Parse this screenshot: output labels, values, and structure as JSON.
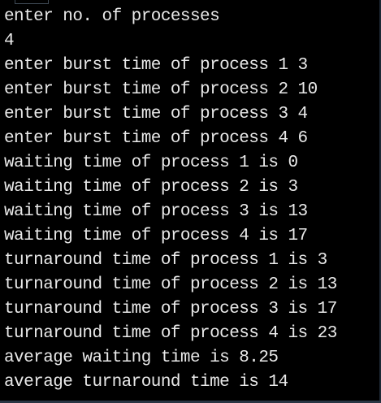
{
  "terminal": {
    "lines": [
      "enter no. of processes",
      "4",
      "enter burst time of process 1 3",
      "enter burst time of process 2 10",
      "enter burst time of process 3 4",
      "enter burst time of process 4 6",
      "waiting time of process 1 is 0",
      "waiting time of process 2 is 3",
      "waiting time of process 3 is 13",
      "waiting time of process 4 is 17",
      "turnaround time of process 1 is 3",
      "turnaround time of process 2 is 13",
      "turnaround time of process 3 is 17",
      "turnaround time of process 4 is 23",
      "average waiting time is 8.25",
      "average turnaround time is 14"
    ]
  },
  "colors": {
    "background": "#000000",
    "text": "#e9e9e9"
  }
}
